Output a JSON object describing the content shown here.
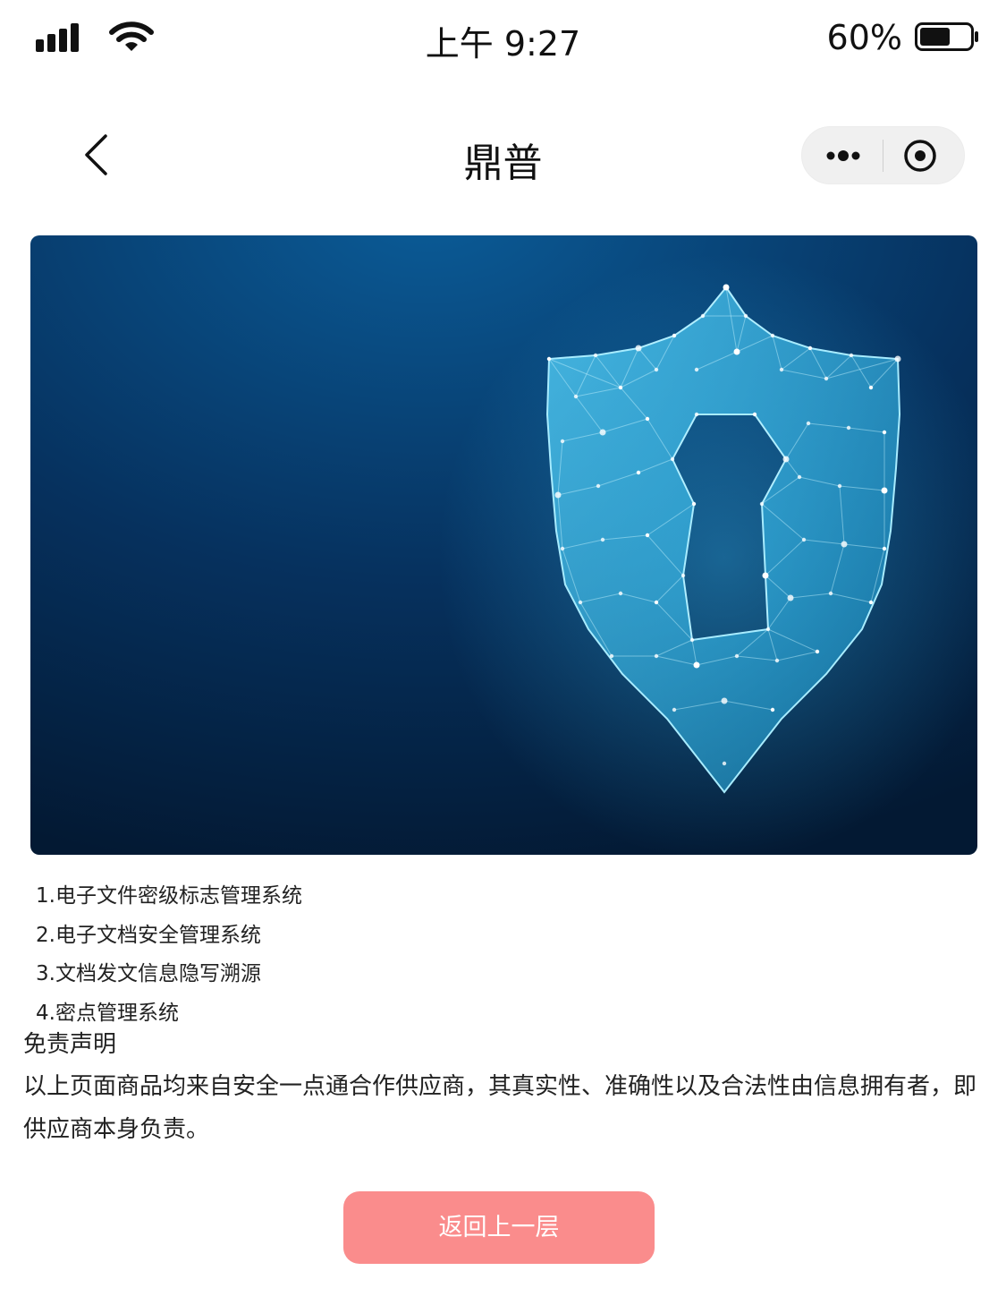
{
  "status_bar": {
    "time": "上午 9:27",
    "battery_percent": "60%",
    "battery_level": 0.6,
    "signal_icon": "signal-bars-icon",
    "wifi_icon": "wifi-icon"
  },
  "nav": {
    "title": "鼎普",
    "back_icon": "chevron-left-icon",
    "more_icon": "more-dots-icon",
    "close_icon": "target-circle-icon"
  },
  "banner": {
    "image": "shield-keyhole-illustration",
    "colors": {
      "background_top": "#0a4f86",
      "background_bottom": "#031a36",
      "glow": "#4fd2ff"
    }
  },
  "features": [
    "1.电子文件密级标志管理系统",
    "2.电子文档安全管理系统",
    "3.文档发文信息隐写溯源",
    "4.密点管理系统"
  ],
  "disclaimer": {
    "title": "免责声明",
    "text": "以上页面商品均来自安全一点通合作供应商，其真实性、准确性以及合法性由信息拥有者，即供应商本身负责。"
  },
  "footer": {
    "back_button_label": "返回上一层",
    "button_color": "#fa8c8c"
  }
}
